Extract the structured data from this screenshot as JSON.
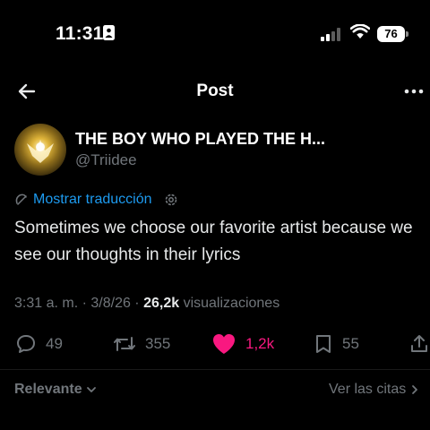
{
  "status_bar": {
    "time": "11:31",
    "battery": "76"
  },
  "header": {
    "title": "Post"
  },
  "author": {
    "display_name": "THE BOY WHO PLAYED THE H...",
    "handle": "@Triidee"
  },
  "translate": {
    "label": "Mostrar traducción"
  },
  "tweet": {
    "text": "Sometimes we choose our favorite artist because we see our thoughts in their lyrics"
  },
  "meta": {
    "time": "3:31 a. m.",
    "separator": " · ",
    "date": "3/8/26",
    "views_count": "26,2k",
    "views_label": "visualizaciones"
  },
  "actions": {
    "replies": "49",
    "reposts": "355",
    "likes": "1,2k",
    "bookmarks": "55",
    "like_color": "#f91880"
  },
  "footer": {
    "sort_label": "Relevante",
    "quotes_label": "Ver las citas"
  },
  "icons": {
    "back": "arrow-left",
    "more": "ellipsis",
    "reply": "speech-bubble",
    "repost": "arrows-loop",
    "like": "heart-filled",
    "bookmark": "bookmark",
    "share": "share-upload"
  }
}
